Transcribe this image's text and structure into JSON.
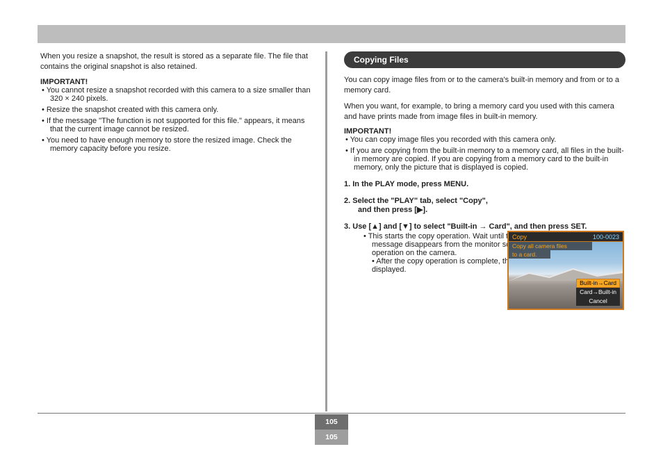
{
  "left": {
    "p1": "When you resize a snapshot, the result is stored as a separate file. The file that contains the original snapshot is also retained.",
    "imp_label": "IMPORTANT!",
    "imp_items": [
      "• You cannot resize a snapshot recorded with this camera to a size smaller than 320 × 240 pixels.",
      "• Resize the snapshot created with this camera only.",
      "• If the message \"The function is not supported for this file.\" appears, it means that the current image cannot be resized.",
      "• You need to have enough memory to store the resized image. Check the memory capacity before you resize."
    ]
  },
  "right": {
    "header": "Copying Files",
    "intro1": "You can copy image files from or to the camera's built-in memory and from or to a memory card.",
    "intro2": "When you want, for example, to bring a memory card you used with this camera and have prints made from image files in built-in memory.",
    "imp_label": "IMPORTANT!",
    "imp_items": [
      "• You can copy image files you recorded with this camera only.",
      "• If you are copying from the built-in memory to a memory card, all files in the built-in memory are copied. If you are copying from a memory card to the built-in memory, only the picture that is displayed is copied."
    ],
    "steps": [
      {
        "num": "1.",
        "title": "In the PLAY mode, press MENU.",
        "sub": ""
      },
      {
        "num": "2.",
        "title": "Select the \"PLAY\" tab, select \"Copy\", and then press [▶].",
        "sub": ""
      },
      {
        "num": "3.",
        "title": "Use [▲] and [▼] to select \"Built-in → Card\", and then press SET.",
        "sub": "• This starts the copy operation. Wait until the \"Busy....please wait...\" message disappears from the monitor screen before performing any operation on the camera.\n• After the copy operation is complete, the last file on that memory is displayed."
      }
    ],
    "screenshot": {
      "title": "Copy",
      "file_no": "100-0023",
      "line1": "Copy all camera files",
      "line2": "to a card.",
      "menu": [
        "Built-in→Card",
        "Card→Built-in",
        "Cancel"
      ]
    }
  },
  "footer": {
    "page_top": "105",
    "page_bot": "105"
  }
}
